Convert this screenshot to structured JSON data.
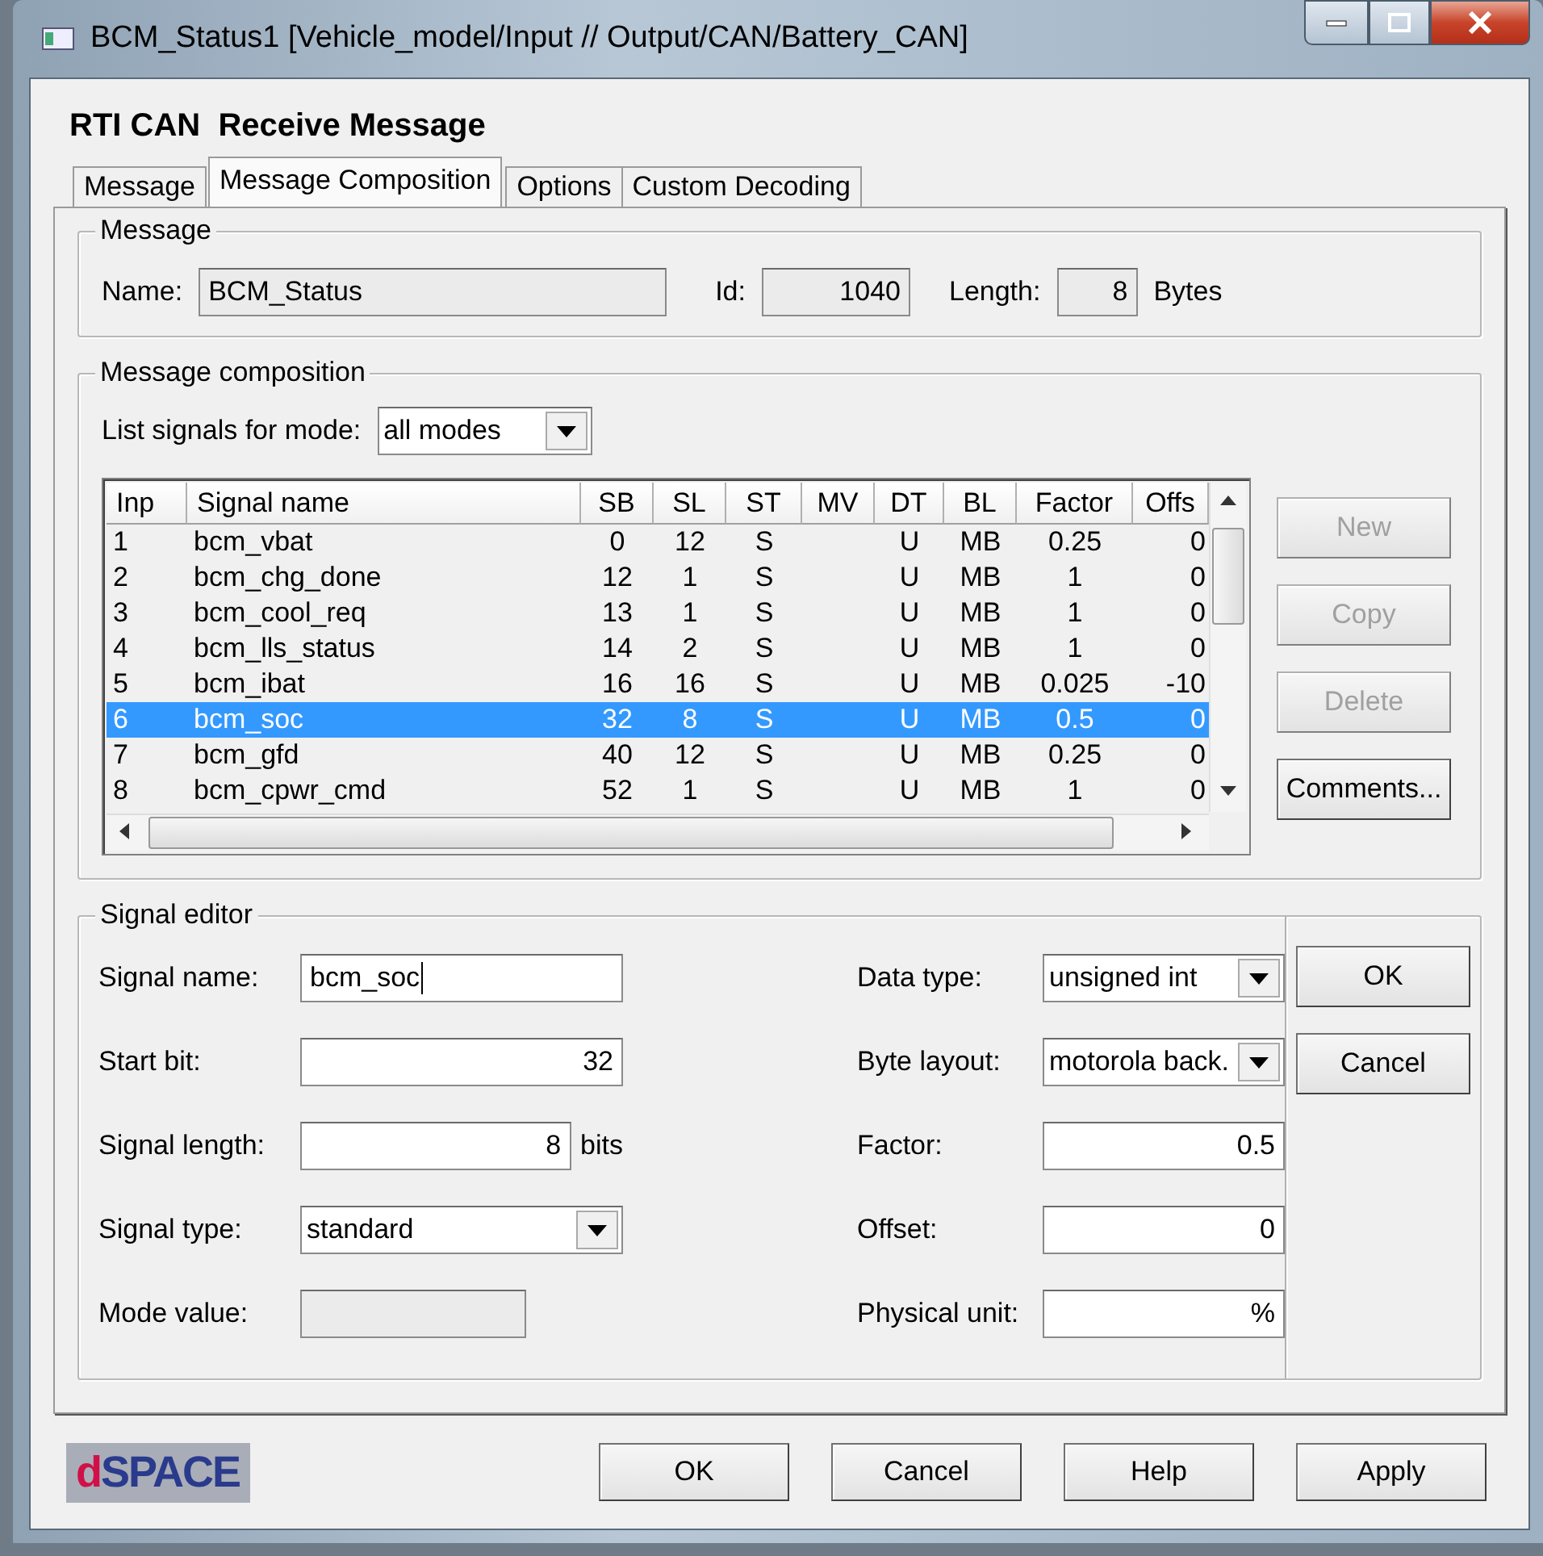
{
  "window": {
    "title": "BCM_Status1  [Vehicle_model/Input // Output/CAN/Battery_CAN]"
  },
  "heading": "RTI CAN  Receive Message",
  "tabs": [
    {
      "label": "Message",
      "selected": false
    },
    {
      "label": "Message Composition",
      "selected": true
    },
    {
      "label": "Options",
      "selected": false
    },
    {
      "label": "Custom Decoding",
      "selected": false
    }
  ],
  "message": {
    "title": "Message",
    "name_label": "Name:",
    "name": "BCM_Status",
    "id_label": "Id:",
    "id": "1040",
    "length_label": "Length:",
    "length": "8",
    "length_unit": "Bytes"
  },
  "composition": {
    "title": "Message composition",
    "mode_label": "List signals for mode:",
    "mode": "all modes",
    "table": {
      "columns": [
        "Inp",
        "Signal name",
        "SB",
        "SL",
        "ST",
        "MV",
        "DT",
        "BL",
        "Factor",
        "Offs"
      ],
      "rows": [
        {
          "cells": [
            "1",
            "bcm_vbat",
            "0",
            "12",
            "S",
            "",
            "U",
            "MB",
            "0.25",
            "0"
          ],
          "selected": false
        },
        {
          "cells": [
            "2",
            "bcm_chg_done",
            "12",
            "1",
            "S",
            "",
            "U",
            "MB",
            "1",
            "0"
          ],
          "selected": false
        },
        {
          "cells": [
            "3",
            "bcm_cool_req",
            "13",
            "1",
            "S",
            "",
            "U",
            "MB",
            "1",
            "0"
          ],
          "selected": false
        },
        {
          "cells": [
            "4",
            "bcm_lls_status",
            "14",
            "2",
            "S",
            "",
            "U",
            "MB",
            "1",
            "0"
          ],
          "selected": false
        },
        {
          "cells": [
            "5",
            "bcm_ibat",
            "16",
            "16",
            "S",
            "",
            "U",
            "MB",
            "0.025",
            "-10"
          ],
          "selected": false
        },
        {
          "cells": [
            "6",
            "bcm_soc",
            "32",
            "8",
            "S",
            "",
            "U",
            "MB",
            "0.5",
            "0"
          ],
          "selected": true
        },
        {
          "cells": [
            "7",
            "bcm_gfd",
            "40",
            "12",
            "S",
            "",
            "U",
            "MB",
            "0.25",
            "0"
          ],
          "selected": false
        },
        {
          "cells": [
            "8",
            "bcm_cpwr_cmd",
            "52",
            "1",
            "S",
            "",
            "U",
            "MB",
            "1",
            "0"
          ],
          "selected": false
        }
      ]
    },
    "buttons": [
      {
        "label": "New",
        "disabled": true
      },
      {
        "label": "Copy",
        "disabled": true
      },
      {
        "label": "Delete",
        "disabled": true
      },
      {
        "label": "Comments...",
        "disabled": false
      }
    ]
  },
  "signal_editor": {
    "title": "Signal editor",
    "left": [
      {
        "label": "Signal name:",
        "kind": "text",
        "value": "bcm_soc",
        "focused": true
      },
      {
        "label": "Start bit:",
        "kind": "number",
        "value": "32"
      },
      {
        "label": "Signal length:",
        "kind": "number",
        "value": "8",
        "unit": "bits"
      },
      {
        "label": "Signal type:",
        "kind": "dropdown",
        "value": "standard"
      },
      {
        "label": "Mode value:",
        "kind": "disabled"
      }
    ],
    "right": [
      {
        "label": "Data type:",
        "kind": "dropdown",
        "value": "unsigned int"
      },
      {
        "label": "Byte layout:",
        "kind": "dropdown",
        "value": "motorola back."
      },
      {
        "label": "Factor:",
        "kind": "number",
        "value": "0.5"
      },
      {
        "label": "Offset:",
        "kind": "number",
        "value": "0"
      },
      {
        "label": "Physical unit:",
        "kind": "number",
        "value": "%"
      }
    ],
    "buttons": [
      "OK",
      "Cancel"
    ]
  },
  "logo": {
    "first": "d",
    "rest": "SPACE"
  },
  "footer_buttons": [
    "OK",
    "Cancel",
    "Help",
    "Apply"
  ]
}
